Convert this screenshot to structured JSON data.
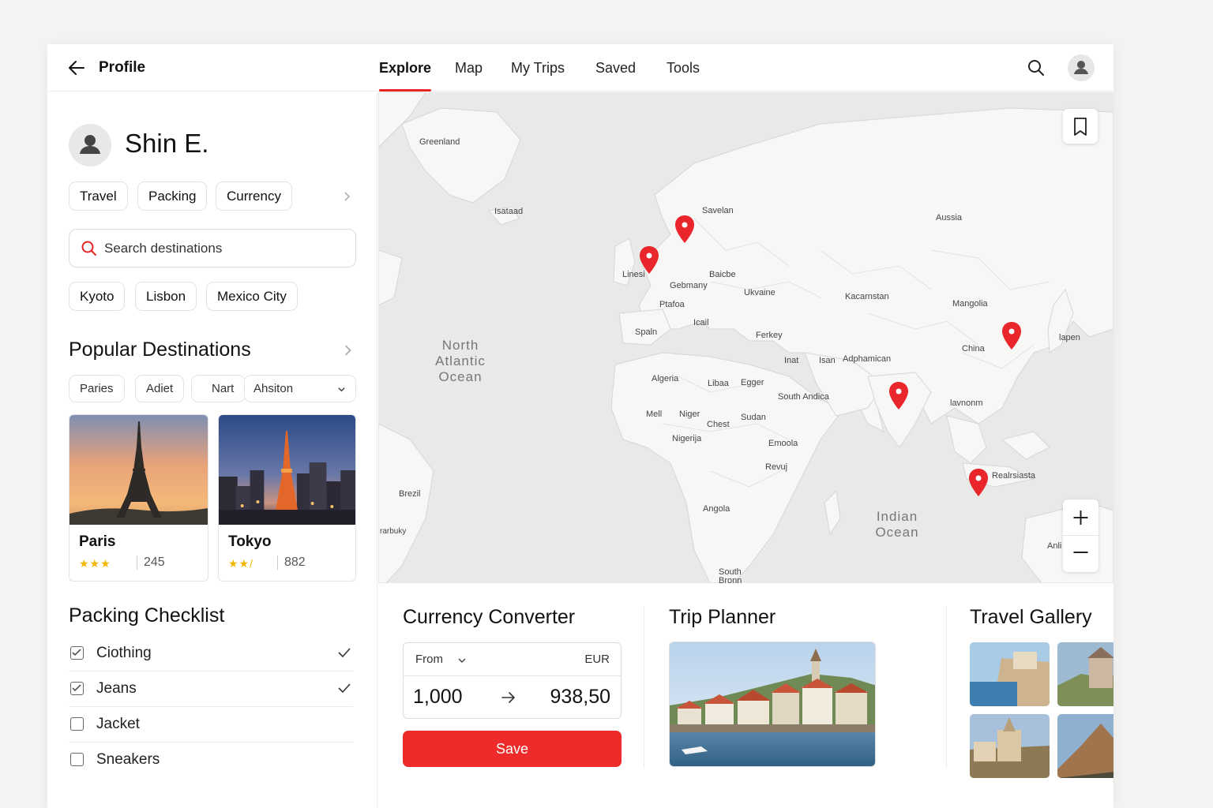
{
  "header": {
    "title": "Profile",
    "tabs": [
      {
        "label": "Explore",
        "active": true
      },
      {
        "label": "Map",
        "active": false
      },
      {
        "label": "My Trips",
        "active": false
      },
      {
        "label": "Saved",
        "active": false
      },
      {
        "label": "Tools",
        "active": false
      }
    ]
  },
  "profile": {
    "name": "Shin E.",
    "chips": [
      "Travel",
      "Packing",
      "Currency"
    ]
  },
  "search": {
    "placeholder": "Search destinations"
  },
  "recent_chips": [
    "Kyoto",
    "Lisbon",
    "Mexico City"
  ],
  "popular": {
    "heading": "Popular Destinations",
    "filters": [
      "Paries",
      "Adiet",
      "Nart",
      "Ahsiton"
    ],
    "cards": [
      {
        "name": "Paris",
        "stars": "★★★",
        "count": "245"
      },
      {
        "name": "Tokyo",
        "stars": "★★/",
        "count": "882"
      }
    ]
  },
  "packing": {
    "heading": "Packing Checklist",
    "items": [
      {
        "label": "Ciothing",
        "checked": true
      },
      {
        "label": "Jeans",
        "checked": true
      },
      {
        "label": "Jacket",
        "checked": false
      },
      {
        "label": "Sneakers",
        "checked": false
      }
    ]
  },
  "map": {
    "labels": [
      "Greenland",
      "Isataad",
      "Savelan",
      "Aussia",
      "Linesi",
      "Baicbe",
      "Gebmany",
      "Ukvaine",
      "Kacarnstan",
      "Mangolia",
      "Ptafoa",
      "Icail",
      "Spaln",
      "Ferkey",
      "Inat",
      "Isan",
      "Adphamican",
      "China",
      "lapen",
      "Algeria",
      "Libaa",
      "Egger",
      "South Andica",
      "Mell",
      "Niger",
      "Chest",
      "Sudan",
      "lavnonm",
      "Nigerija",
      "Emoola",
      "Revuj",
      "Realrsiasta",
      "Brezil",
      "Angola",
      "South Bronn",
      "Anli",
      "rarbuky"
    ],
    "oceans": [
      "North Atlantic Ocean",
      "Indian Ocean"
    ],
    "pin_color": "#e8262b"
  },
  "converter": {
    "heading": "Currency Converter",
    "from_label": "From",
    "to_currency": "EUR",
    "amount_from": "1,000",
    "amount_to": "938,50",
    "save_label": "Save"
  },
  "planner": {
    "heading": "Trip Planner"
  },
  "gallery": {
    "heading": "Travel Gallery"
  },
  "colors": {
    "accent": "#e52424",
    "star": "#f2b600"
  }
}
